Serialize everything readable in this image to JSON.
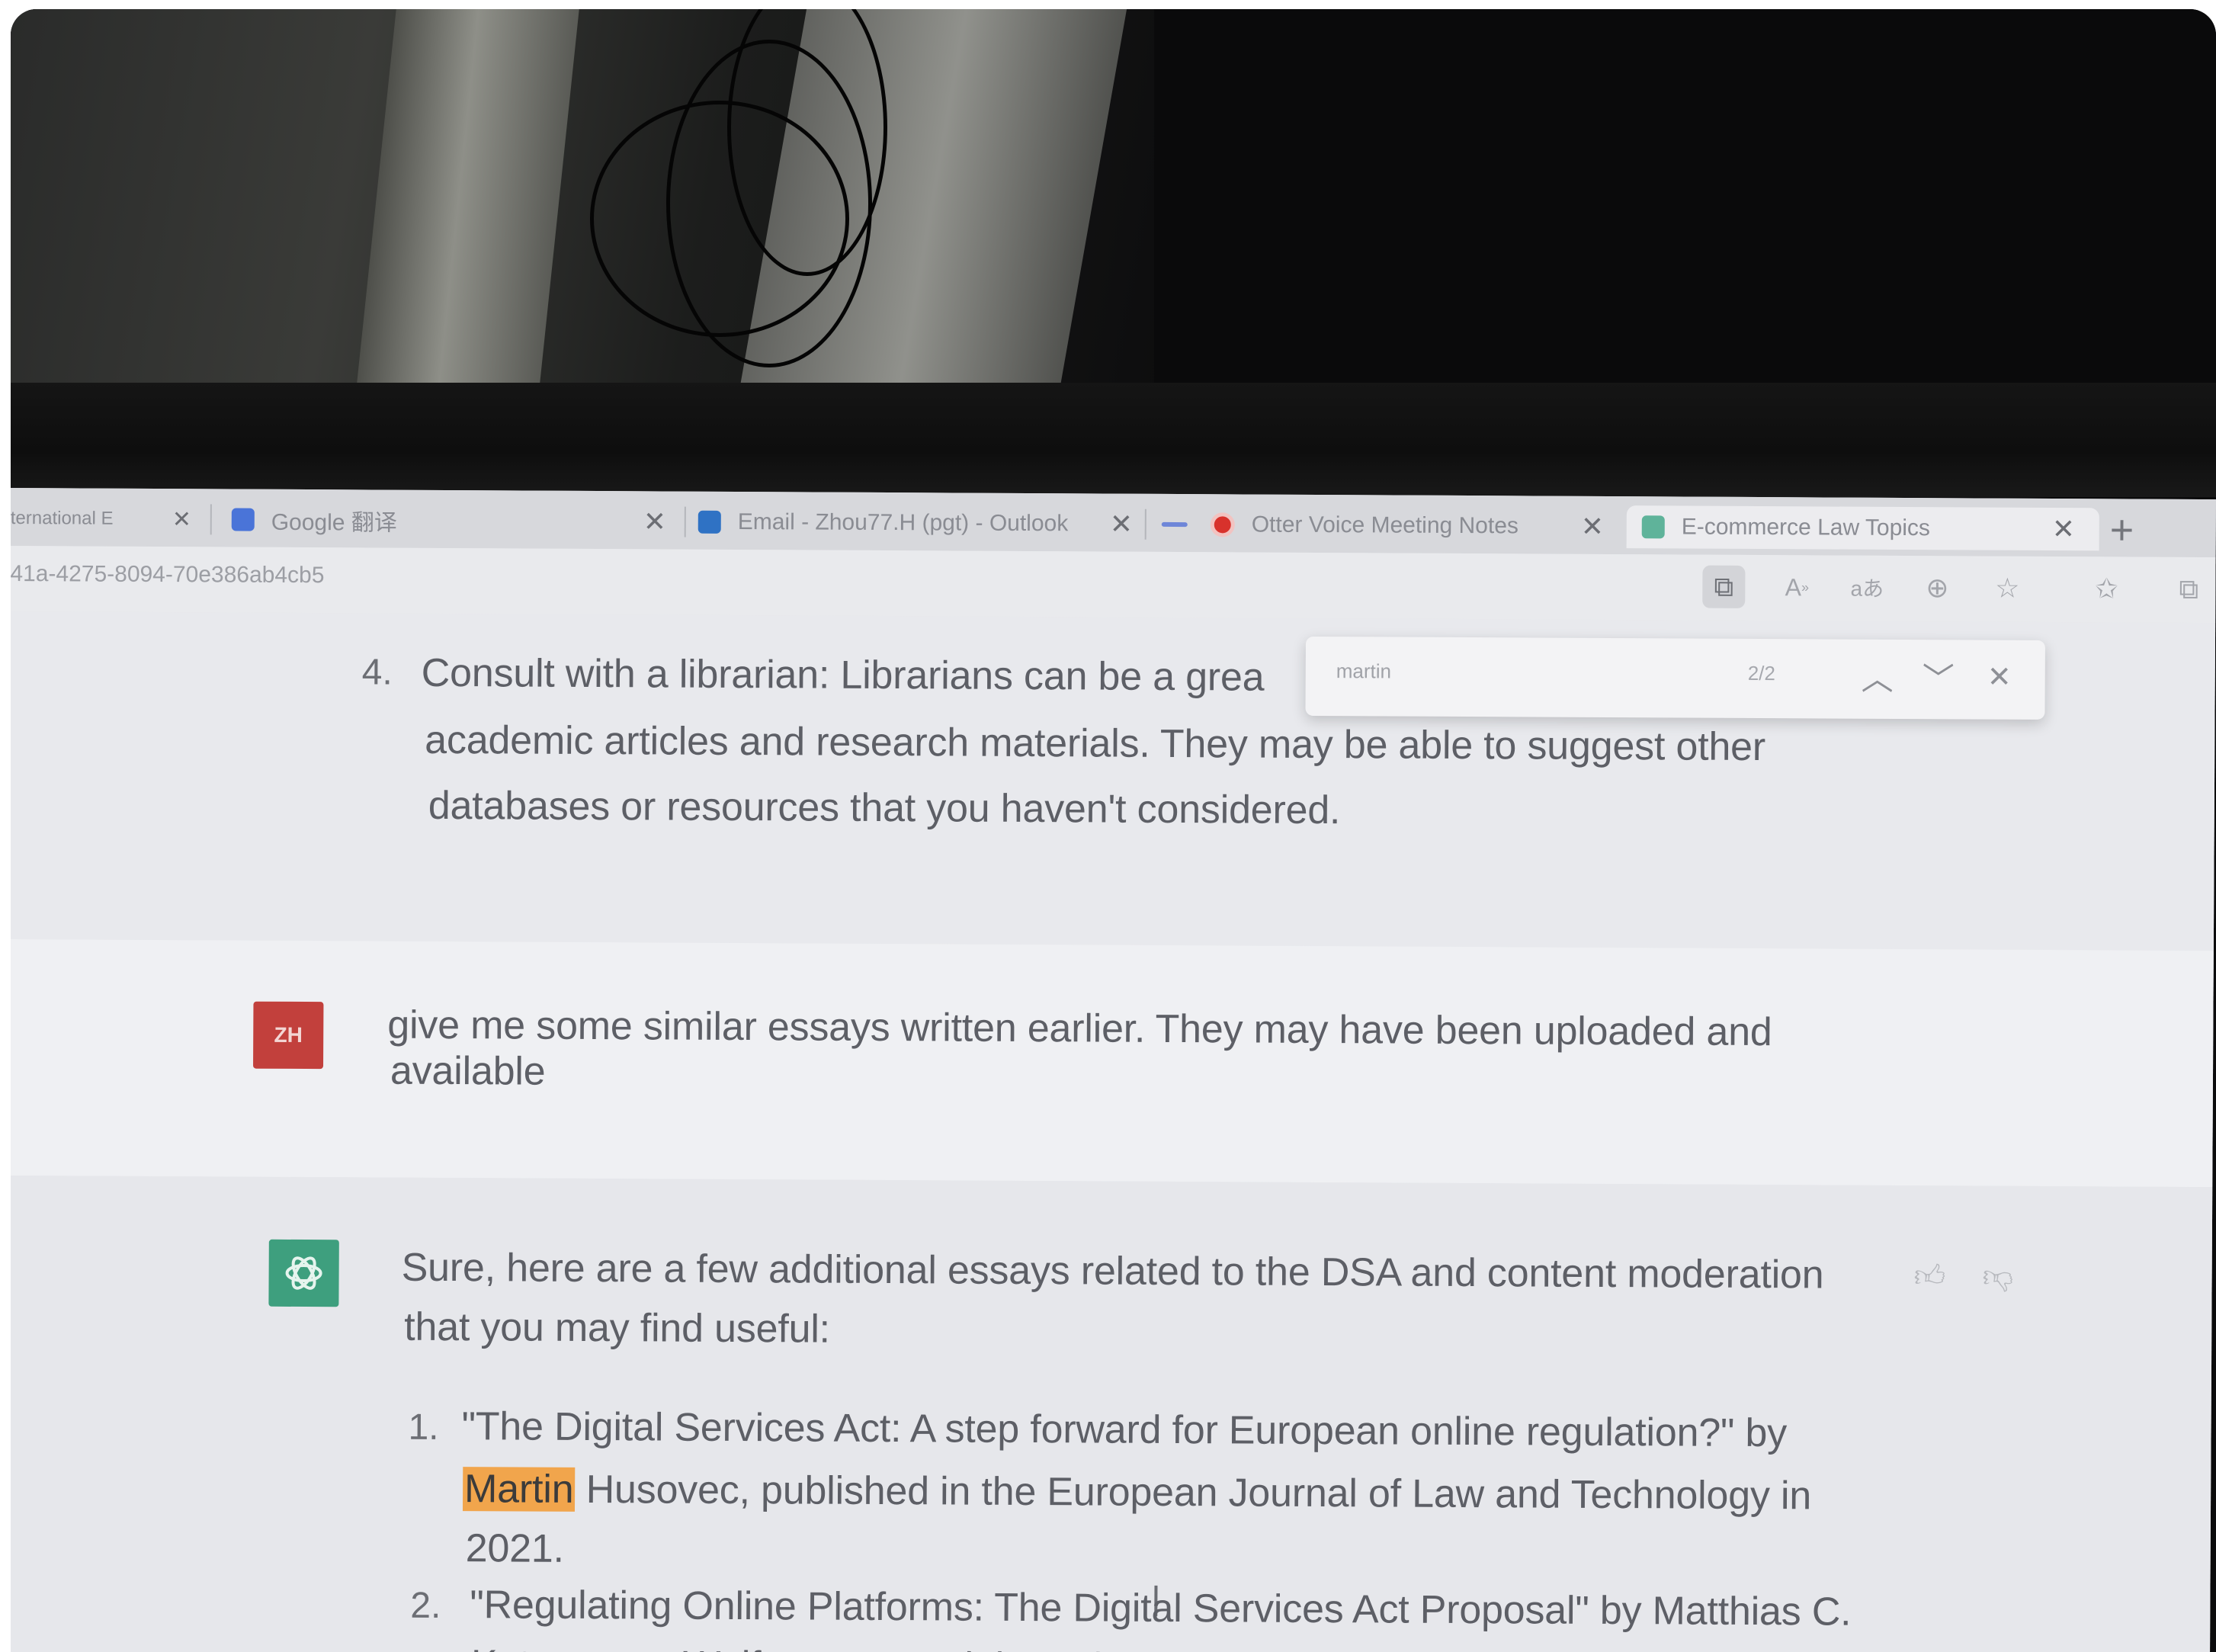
{
  "browser": {
    "tabs": [
      {
        "label": "ternational E",
        "favicon": "page-icon",
        "color": "#9ea0a6"
      },
      {
        "label": "Google 翻译",
        "favicon": "translate-icon",
        "color": "#4a74d8"
      },
      {
        "label": "Email - Zhou77.H (pgt) - Outlook",
        "favicon": "outlook-icon",
        "color": "#2f72c4"
      },
      {
        "label": "Otter Voice Meeting Notes",
        "favicon": "otter-record-icon",
        "color": "#d8322c"
      },
      {
        "label": "E-commerce Law Topics",
        "favicon": "chatgpt-icon",
        "color": "#5fb39a"
      }
    ],
    "new_tab_symbol": "+",
    "close_symbol": "✕",
    "url": "41a-4275-8094-70e386ab4cb5",
    "toolbar_icons": [
      "app-available-icon",
      "read-aloud-icon",
      "translate-icon",
      "zoom-icon",
      "add-favorite-icon",
      "favorites-icon",
      "collections-icon"
    ]
  },
  "find_bar": {
    "query": "martin",
    "count": "2/2",
    "prev_symbol": "︿",
    "next_symbol": "﹀",
    "close_symbol": "✕"
  },
  "chat": {
    "prev_item": {
      "number": "4.",
      "line1": "Consult with a librarian: Librarians can be a grea",
      "line2": "academic articles and research materials. They may be able to suggest other",
      "line3": "databases or resources that you haven't considered."
    },
    "user": {
      "avatar": "ZH",
      "line1": "give me some similar essays written earlier. They may have been uploaded and",
      "line2": "available"
    },
    "assistant": {
      "intro1": "Sure, here are a few additional essays related to the DSA and content moderation",
      "intro2": "that you may find useful:",
      "items": [
        {
          "number": "1.",
          "line1": "\"The Digital Services Act: A step forward for European online regulation?\" by",
          "highlight": "Martin",
          "line2_rest": " Husovec, published in the European Journal of Law and Technology in",
          "line3": "2021."
        },
        {
          "number": "2.",
          "line1": "\"Regulating Online Platforms: The Digital Services Act Proposal\" by Matthias C.",
          "line2": "Kettemann, Wolfgang Benedek, and Matthias C. Kettemann, published in the"
        }
      ]
    }
  }
}
